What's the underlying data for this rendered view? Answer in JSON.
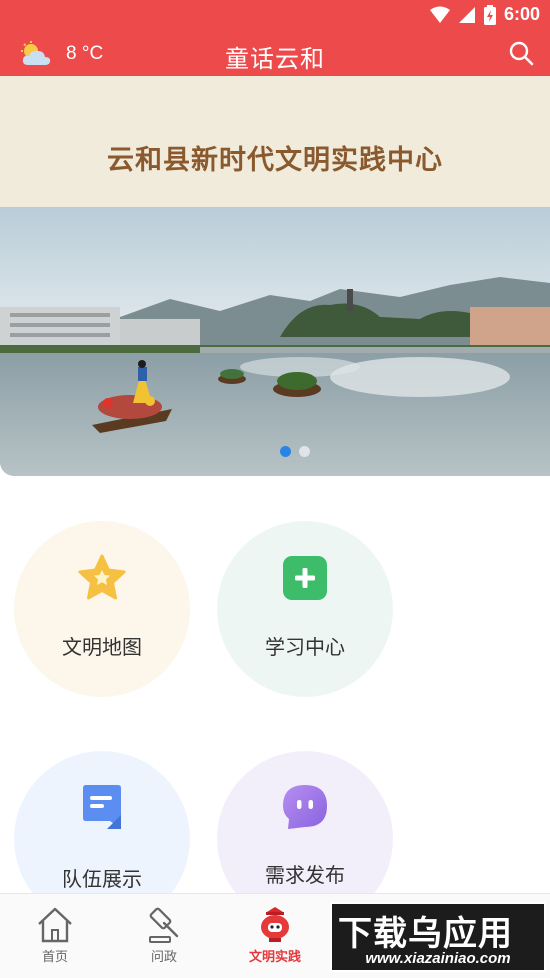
{
  "status_bar": {
    "time": "6:00",
    "icons": [
      "wifi-icon",
      "signal-icon",
      "battery-icon"
    ]
  },
  "header": {
    "weather_icon": "partly-cloudy-icon",
    "temperature": "8 °C",
    "app_title": "童话云和",
    "search_icon": "search-icon"
  },
  "banner": {
    "title": "云和县新时代文明实践中心"
  },
  "carousel": {
    "slide_count": 2,
    "active_index": 0,
    "image_description_icon": "lake-town-photo"
  },
  "features": [
    {
      "label": "文明地图",
      "icon": "star-icon"
    },
    {
      "label": "学习中心",
      "icon": "plus-icon"
    },
    {
      "label": "队伍展示",
      "icon": "bookmark-icon"
    },
    {
      "label": "需求发布",
      "icon": "chat-bubble-icon"
    }
  ],
  "bottom_nav": {
    "items": [
      {
        "label": "首页",
        "icon": "home-icon",
        "active": false
      },
      {
        "label": "问政",
        "icon": "gavel-icon",
        "active": false
      },
      {
        "label": "文明实践",
        "icon": "lantern-mascot-icon",
        "active": true
      }
    ]
  },
  "watermark": {
    "text": "下载乌应用",
    "url": "www.xiazainiao.com"
  },
  "colors": {
    "brand_red": "#ec4a4b",
    "banner_bg": "#f1ebdc",
    "banner_text": "#8a5a2e",
    "active_dot": "#2a84e6"
  }
}
